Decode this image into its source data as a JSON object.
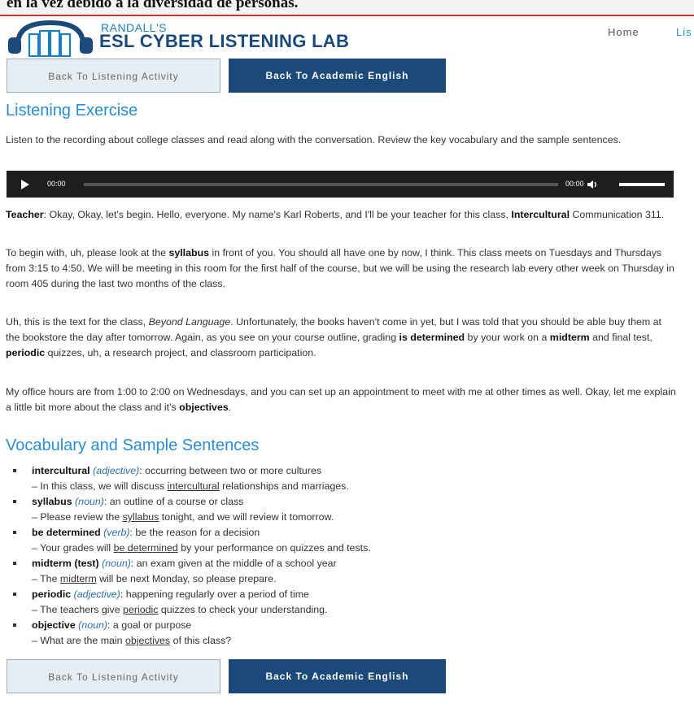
{
  "top_banner": {
    "text": "en la vez debido a la diversidad de personas."
  },
  "header": {
    "logo_small": "RANDALL'S",
    "logo_big": "ESL CYBER LISTENING LAB",
    "nav": [
      "Home",
      "Lis"
    ]
  },
  "buttons": {
    "back_activity": "Back To Listening Activity",
    "back_academic": "Back To Academic English"
  },
  "exercise": {
    "heading": "Listening Exercise",
    "intro": "Listen to the recording about college classes and read along with the conversation. Review the key vocabulary and the sample sentences."
  },
  "audio": {
    "current_time": "00:00",
    "duration": "00:00"
  },
  "transcript": {
    "p1_speaker": "Teacher",
    "p1_a": ": Okay, Okay, let's begin. Hello, everyone. My name's Karl Roberts, and I'll be your teacher for this class, ",
    "p1_b": "Intercultural",
    "p1_c": " Communication 311.",
    "p2_a": "To begin with, uh, please look at the ",
    "p2_b": "syllabus",
    "p2_c": " in front of you. You should all have one by now, I think. This class meets on Tuesdays and Thursdays from 3:15 to 4:50. We will be meeting in this room for the first half of the course, but we will be using the research lab every other week on Thursday in room 405 during the last two months of the class.",
    "p3_a": "Uh, this is the text for the class, ",
    "p3_b": "Beyond Language",
    "p3_c": ". Unfortunately, the books haven't come in yet, but I was told that you should be able buy them at the bookstore the day after tomorrow. Again, as you see on your course outline, grading ",
    "p3_d": "is determined",
    "p3_e": " by your work on a ",
    "p3_f": "midterm",
    "p3_g": " and final test, ",
    "p3_h": "periodic",
    "p3_i": " quizzes, uh, a research project, and classroom participation.",
    "p4_a": "My office hours are from 1:00 to 2:00 on Wednesdays, and you can set up an appointment to meet with me at other times as well. Okay, let me explain a little bit more about the class and it's ",
    "p4_b": "objectives",
    "p4_c": "."
  },
  "vocabulary": {
    "heading": "Vocabulary and Sample Sentences",
    "items": [
      {
        "term": "intercultural",
        "pos": "(adjective)",
        "def": ": occurring between two or more cultures",
        "ex_a": "– In this class, we will discuss ",
        "ex_u": "intercultural",
        "ex_b": " relationships and marriages."
      },
      {
        "term": "syllabus",
        "pos": "(noun)",
        "def": ": an outline of a course or class",
        "ex_a": "– Please review the ",
        "ex_u": "syllabus",
        "ex_b": " tonight, and we will review it tomorrow."
      },
      {
        "term": "be determined",
        "pos": "(verb)",
        "def": ": be the reason for a decision",
        "ex_a": "– Your grades will ",
        "ex_u": "be determined",
        "ex_b": " by your performance on quizzes and tests."
      },
      {
        "term": "midterm (test)",
        "pos": "(noun)",
        "def": ": an exam given at the middle of a school year",
        "ex_a": "– The ",
        "ex_u": "midterm",
        "ex_b": " will be next Monday, so please prepare."
      },
      {
        "term": "periodic",
        "pos": "(adjective)",
        "def": ": happening regularly over a period of time",
        "ex_a": "– The teachers give ",
        "ex_u": "periodic",
        "ex_b": " quizzes to check your understanding."
      },
      {
        "term": "objective",
        "pos": "(noun)",
        "def": ": a goal or purpose",
        "ex_a": "– What are the main ",
        "ex_u": "objectives",
        "ex_b": " of this class?"
      }
    ]
  }
}
